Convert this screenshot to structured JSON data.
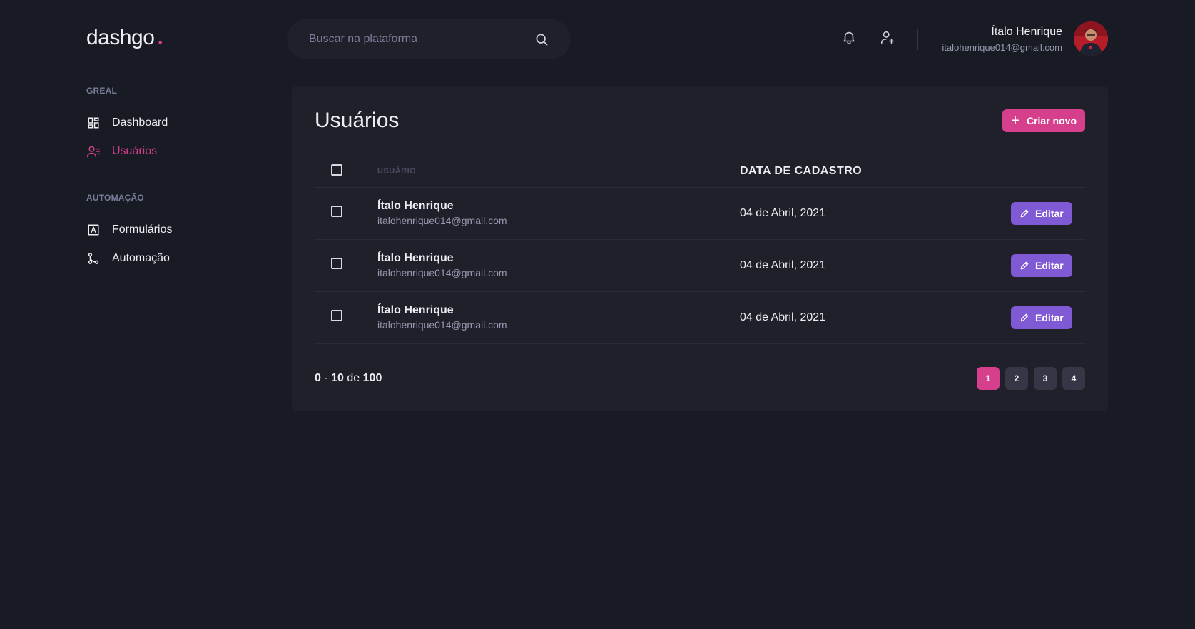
{
  "header": {
    "logo": "dashgo",
    "logo_dot": ".",
    "search_placeholder": "Buscar na plataforma",
    "user": {
      "name": "Ítalo Henrique",
      "email": "italohenrique014@gmail.com"
    }
  },
  "sidebar": {
    "sections": [
      {
        "title": "GREAL",
        "items": [
          {
            "label": "Dashboard",
            "icon": "dashboard-icon",
            "active": false
          },
          {
            "label": "Usuários",
            "icon": "users-icon",
            "active": true
          }
        ]
      },
      {
        "title": "AUTOMAÇÃO",
        "items": [
          {
            "label": "Formulários",
            "icon": "form-icon",
            "active": false
          },
          {
            "label": "Automação",
            "icon": "git-merge-icon",
            "active": false
          }
        ]
      }
    ]
  },
  "main": {
    "title": "Usuários",
    "create_label": "Criar novo",
    "table": {
      "columns": [
        "USUÁRIO",
        "DATA DE CADASTRO"
      ],
      "rows": [
        {
          "name": "Ítalo Henrique",
          "email": "italohenrique014@gmail.com",
          "date": "04 de Abril, 2021",
          "edit_label": "Editar"
        },
        {
          "name": "Ítalo Henrique",
          "email": "italohenrique014@gmail.com",
          "date": "04 de Abril, 2021",
          "edit_label": "Editar"
        },
        {
          "name": "Ítalo Henrique",
          "email": "italohenrique014@gmail.com",
          "date": "04 de Abril, 2021",
          "edit_label": "Editar"
        }
      ]
    },
    "pagination": {
      "from": "0",
      "sep": "-",
      "to": "10",
      "of": "de",
      "total": "100",
      "pages": [
        "1",
        "2",
        "3",
        "4"
      ],
      "current": "1"
    }
  },
  "colors": {
    "background": "#181b23",
    "panel": "#1f2029",
    "accent_pink": "#d53f8c",
    "accent_purple": "#805ad5"
  }
}
